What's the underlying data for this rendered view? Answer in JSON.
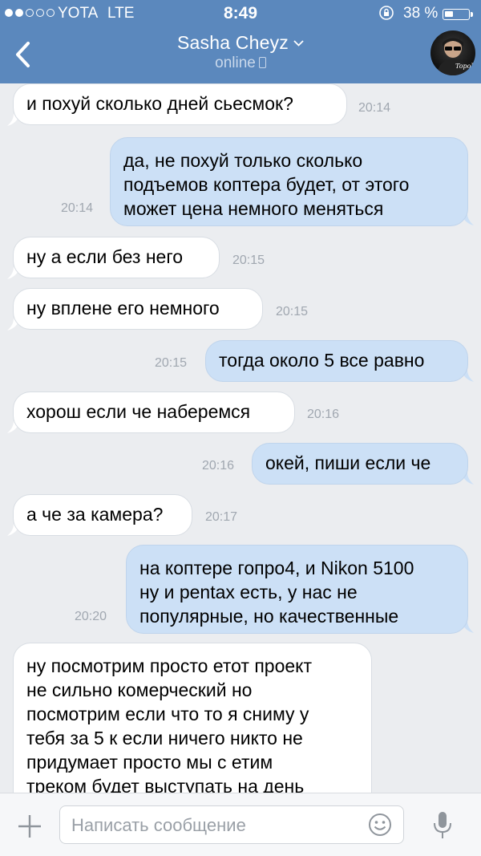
{
  "status_bar": {
    "carrier": "YOTA",
    "network": "LTE",
    "time": "8:49",
    "battery": "38 %",
    "battery_level": 0.38,
    "signal_bars_filled": 2,
    "signal_bars_total": 5
  },
  "header": {
    "contact_name": "Sasha Cheyz",
    "status": "online",
    "avatar_caption": "Topol"
  },
  "messages": [
    {
      "direction": "in",
      "lines": [
        "и похуй сколько дней сьесмок?"
      ],
      "time": "20:14"
    },
    {
      "direction": "out",
      "lines": [
        "да, не похуй только сколько",
        "подъемов коптера будет, от этого",
        "может цена немного меняться"
      ],
      "time": "20:14"
    },
    {
      "direction": "in",
      "lines": [
        "ну а если без него"
      ],
      "time": "20:15"
    },
    {
      "direction": "in",
      "lines": [
        "ну вплене его немного"
      ],
      "time": "20:15"
    },
    {
      "direction": "out",
      "lines": [
        "тогда около 5 все равно"
      ],
      "time": "20:15"
    },
    {
      "direction": "in",
      "lines": [
        "хорош если че наберемся"
      ],
      "time": "20:16"
    },
    {
      "direction": "out",
      "lines": [
        "окей, пиши если че"
      ],
      "time": "20:16"
    },
    {
      "direction": "in",
      "lines": [
        "а че за камера?"
      ],
      "time": "20:17"
    },
    {
      "direction": "out",
      "lines": [
        "на коптере гопро4, и Nikon 5100",
        "ну и pentax есть, у нас не",
        "популярные, но качественные"
      ],
      "time": "20:20"
    },
    {
      "direction": "in",
      "lines": [
        "ну посмотрим просто етот проект",
        "не сильно комерческий но",
        "посмотрим если что то я сниму у",
        "тебя за 5 к если ничего никто не",
        "придумает просто мы с етим",
        "треком будет выступать на день"
      ],
      "time": ""
    }
  ],
  "input": {
    "placeholder": "Написать сообщение",
    "value": ""
  },
  "icons": {
    "back": "chevron-left-icon",
    "title_dropdown": "chevron-down-icon",
    "attach": "plus-icon",
    "emoji": "smile-icon",
    "voice": "microphone-icon",
    "rotation_lock": "rotation-lock-icon",
    "online_device": "phone-icon"
  },
  "colors": {
    "header_bg": "#5b88bd",
    "chat_bg": "#ebedf0",
    "incoming_bubble": "#ffffff",
    "outgoing_bubble": "#cce0f6",
    "timestamp": "#a0a7b0"
  }
}
